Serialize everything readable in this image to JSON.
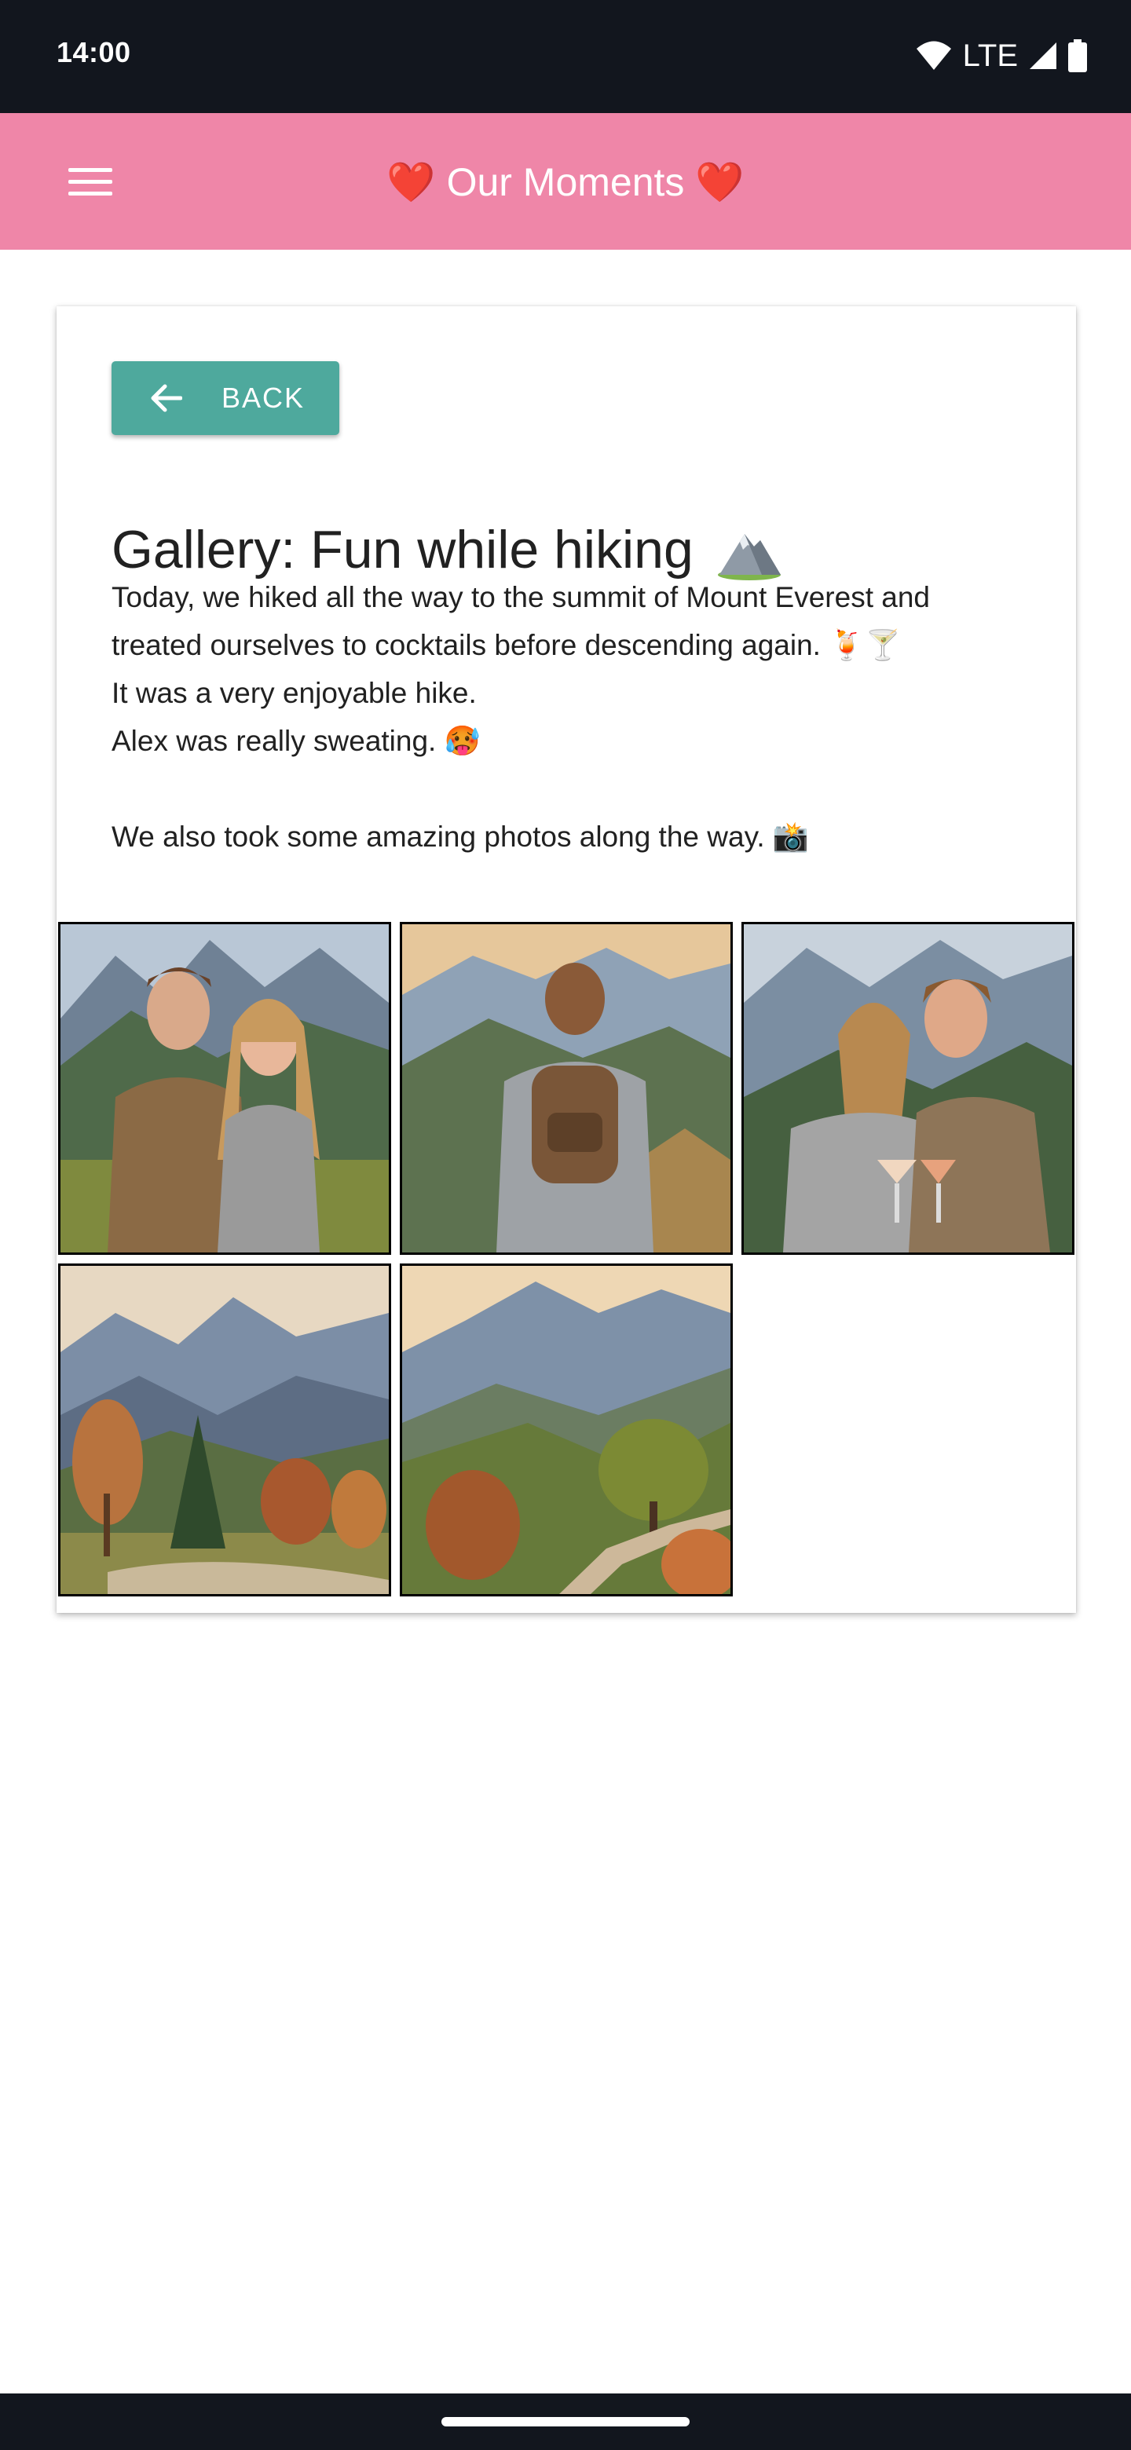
{
  "status_bar": {
    "time": "14:00",
    "network": "LTE",
    "icons": [
      "wifi-icon",
      "cell-signal-icon",
      "battery-icon"
    ]
  },
  "app_bar": {
    "title": "Our Moments",
    "title_decoration": "❤️",
    "menu_icon": "hamburger-menu-icon",
    "background_color": "#ef86a8"
  },
  "page": {
    "back_button_label": "BACK",
    "back_icon": "arrow-left-icon",
    "back_button_color": "#4ea99d",
    "gallery_title": "Gallery: Fun while hiking",
    "gallery_title_emoji": "⛰️",
    "description_lines": [
      "Today, we hiked all the way to the summit of Mount Everest and",
      "treated ourselves to cocktails before descending again. 🍹🍸",
      "It was a very enjoyable hike.",
      "Alex was really sweating. 🥵",
      "",
      "We also took some amazing photos along the way. 📸"
    ]
  },
  "gallery": {
    "photos": [
      {
        "subject": "couple-portrait-mountains"
      },
      {
        "subject": "hiker-with-backpack-view"
      },
      {
        "subject": "couple-with-cocktails"
      },
      {
        "subject": "autumn-mountain-valley"
      },
      {
        "subject": "mountain-trail-landscape"
      }
    ]
  }
}
